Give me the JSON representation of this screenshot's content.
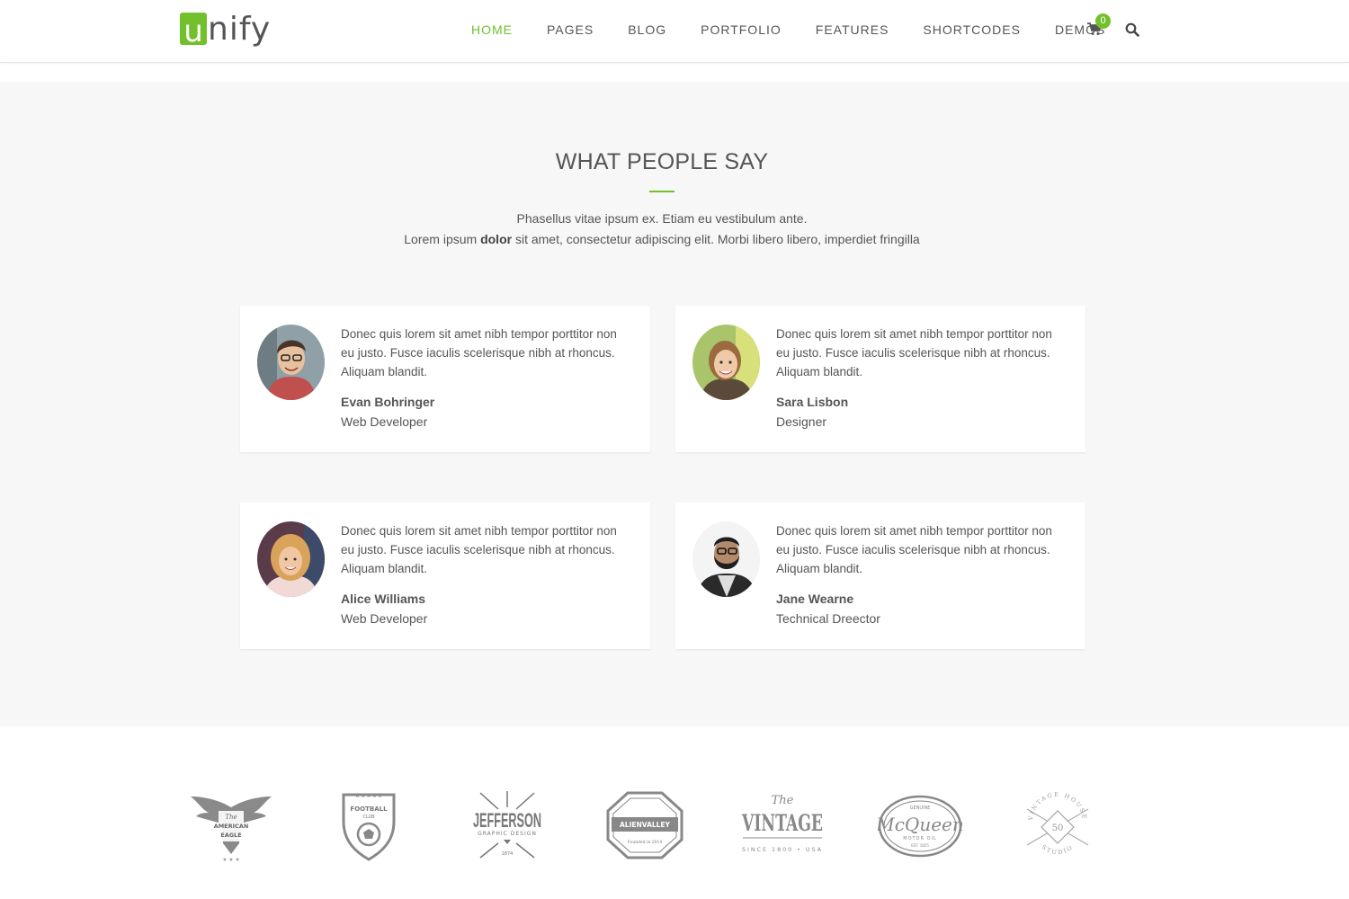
{
  "brand": {
    "logo_letter": "u",
    "logo_rest": "nify"
  },
  "colors": {
    "accent": "#72c02c",
    "text": "#555555",
    "section_bg": "#f7f7f7"
  },
  "nav": {
    "items": [
      {
        "label": "HOME",
        "active": true
      },
      {
        "label": "PAGES"
      },
      {
        "label": "BLOG"
      },
      {
        "label": "PORTFOLIO"
      },
      {
        "label": "FEATURES"
      },
      {
        "label": "SHORTCODES"
      },
      {
        "label": "DEMOS"
      }
    ],
    "cart_count": "0",
    "cart_icon": "shopping-cart-icon",
    "search_icon": "search-icon"
  },
  "testimonials": {
    "title": "WHAT PEOPLE SAY",
    "subtitle_line1": "Phasellus vitae ipsum ex. Etiam eu vestibulum ante.",
    "subtitle_line2_before": "Lorem ipsum ",
    "subtitle_line2_bold": "dolor",
    "subtitle_line2_after": " sit amet, consectetur adipiscing elit. Morbi libero libero, imperdiet fringilla",
    "cards": [
      {
        "text": "Donec quis lorem sit amet nibh tempor porttitor non eu justo. Fusce iaculis scelerisque nibh at rhoncus. Aliquam blandit.",
        "name": "Evan Bohringer",
        "role": "Web Developer"
      },
      {
        "text": "Donec quis lorem sit amet nibh tempor porttitor non eu justo. Fusce iaculis scelerisque nibh at rhoncus. Aliquam blandit.",
        "name": "Sara Lisbon",
        "role": "Designer"
      },
      {
        "text": "Donec quis lorem sit amet nibh tempor porttitor non eu justo. Fusce iaculis scelerisque nibh at rhoncus. Aliquam blandit.",
        "name": "Alice Williams",
        "role": "Web Developer"
      },
      {
        "text": "Donec quis lorem sit amet nibh tempor porttitor non eu justo. Fusce iaculis scelerisque nibh at rhoncus. Aliquam blandit.",
        "name": "Jane Wearne",
        "role": "Technical Dreector"
      }
    ]
  },
  "clients": {
    "american_eagle": {
      "line1": "The",
      "line2": "AMERICAN",
      "line3": "EAGLE"
    },
    "football_club": {
      "line1": "FOOTBALL",
      "line2": "CLUB"
    },
    "jefferson": {
      "line1": "JEFFERSON",
      "line2": "GRAPHIC DESIGN",
      "line3": "1874"
    },
    "alienvalley": {
      "line1": "ALIENVALLEY",
      "line2": "Founded in 2014"
    },
    "vintage": {
      "line1": "The",
      "line2": "VINTAGE",
      "line3": "SINCE 1800 • USA"
    },
    "mcqueen": {
      "line1": "GENUINE",
      "line2": "McQueen",
      "line3": "MOTOR OIL",
      "line4": "EST. 1855"
    },
    "vintage_house": {
      "line1": "VINTAGE HOUSE",
      "line2": "50",
      "line3": "STUDIO"
    }
  }
}
